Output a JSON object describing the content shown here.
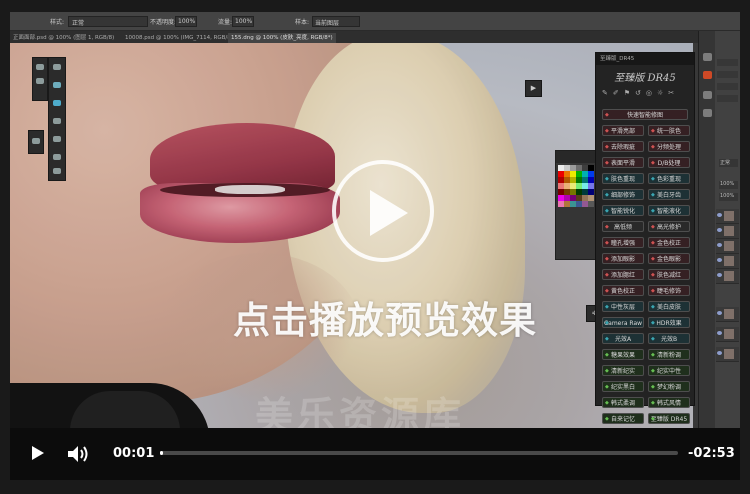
{
  "photoshop": {
    "options": {
      "style_label": "样式:",
      "style_value": "正常",
      "opacity_label": "不透明度:",
      "opacity_value": "100%",
      "flow_label": "流量:",
      "flow_value": "100%",
      "sample_label": "样本:",
      "sample_value": "当前图层"
    },
    "tabs": [
      "正面面部.psd @ 100% (图层 1, RGB/8)",
      "10008.psd @ 100% (IMG_7114, RGB/8)",
      "155.dng @ 100% (皮肤_亮度, RGB/8*)"
    ],
    "right_panel": {
      "mode_value": "正常",
      "opacity_value": "100%",
      "fill_value": "100%"
    }
  },
  "swatches_colors": [
    "#ffffff",
    "#dddddd",
    "#aaaaaa",
    "#777777",
    "#444444",
    "#000000",
    "#ff0000",
    "#ff8000",
    "#ffff00",
    "#00c000",
    "#00c0c0",
    "#0040ff",
    "#c00000",
    "#c06000",
    "#c0c000",
    "#008000",
    "#008080",
    "#0000c0",
    "#ff8080",
    "#ffc080",
    "#ffff80",
    "#80ff80",
    "#80ffff",
    "#8080ff",
    "#800000",
    "#804000",
    "#808000",
    "#004000",
    "#004040",
    "#000080",
    "#ff00ff",
    "#c000c0",
    "#800080",
    "#604020",
    "#a08060",
    "#c0a080",
    "#ff80c0",
    "#c08040",
    "#40a0a0",
    "#4060a0",
    "#a060a0",
    "#606060"
  ],
  "plugin": {
    "header": "至臻版_DR45",
    "brand": "至臻版 DR45",
    "buttons": [
      {
        "left": "快速智能修图",
        "right": "",
        "tone": "red"
      },
      {
        "left": "平滑亮部",
        "right": "统一肤色",
        "tone": "red"
      },
      {
        "left": "去除瑕疵",
        "right": "分频处理",
        "tone": "red"
      },
      {
        "left": "表面平滑",
        "right": "D/B处理",
        "tone": "red"
      },
      {
        "left": "肤色重现",
        "right": "色彩重现",
        "tone": "teal"
      },
      {
        "left": "细部修饰",
        "right": "美白牙齿",
        "tone": "teal"
      },
      {
        "left": "智能锐化",
        "right": "智能液化",
        "tone": "teal"
      },
      {
        "left": "高低频",
        "right": "高光修护",
        "tone": "gray"
      },
      {
        "left": "瞳孔增强",
        "right": "金色校正",
        "tone": "red"
      },
      {
        "left": "添加眼影",
        "right": "金色眼影",
        "tone": "red"
      },
      {
        "left": "添加腮红",
        "right": "肤色减红",
        "tone": "red"
      },
      {
        "left": "黄色校正",
        "right": "睫毛修饰",
        "tone": "red"
      },
      {
        "left": "中性灰层",
        "right": "美白皮肤",
        "tone": "teal"
      },
      {
        "left": "Camera Raw",
        "right": "HDR效果",
        "tone": "teal"
      },
      {
        "left": "光效A",
        "right": "光效B",
        "tone": "teal"
      },
      {
        "left": "糖果效果",
        "right": "清新粉调",
        "tone": "green"
      },
      {
        "left": "清新纪实",
        "right": "纪实中性",
        "tone": "green"
      },
      {
        "left": "纪实黑白",
        "right": "梦幻粉调",
        "tone": "green"
      },
      {
        "left": "韩式柔调",
        "right": "韩式风情",
        "tone": "green"
      },
      {
        "left": "自来记忆",
        "right": "至臻版 DR45",
        "tone": "green"
      }
    ]
  },
  "overlay": {
    "cta": "点击播放预览效果",
    "watermark": "美乐资源库"
  },
  "player": {
    "current_time": "00:01",
    "remaining_time": "-02:53",
    "progress_fraction": 0.006
  }
}
